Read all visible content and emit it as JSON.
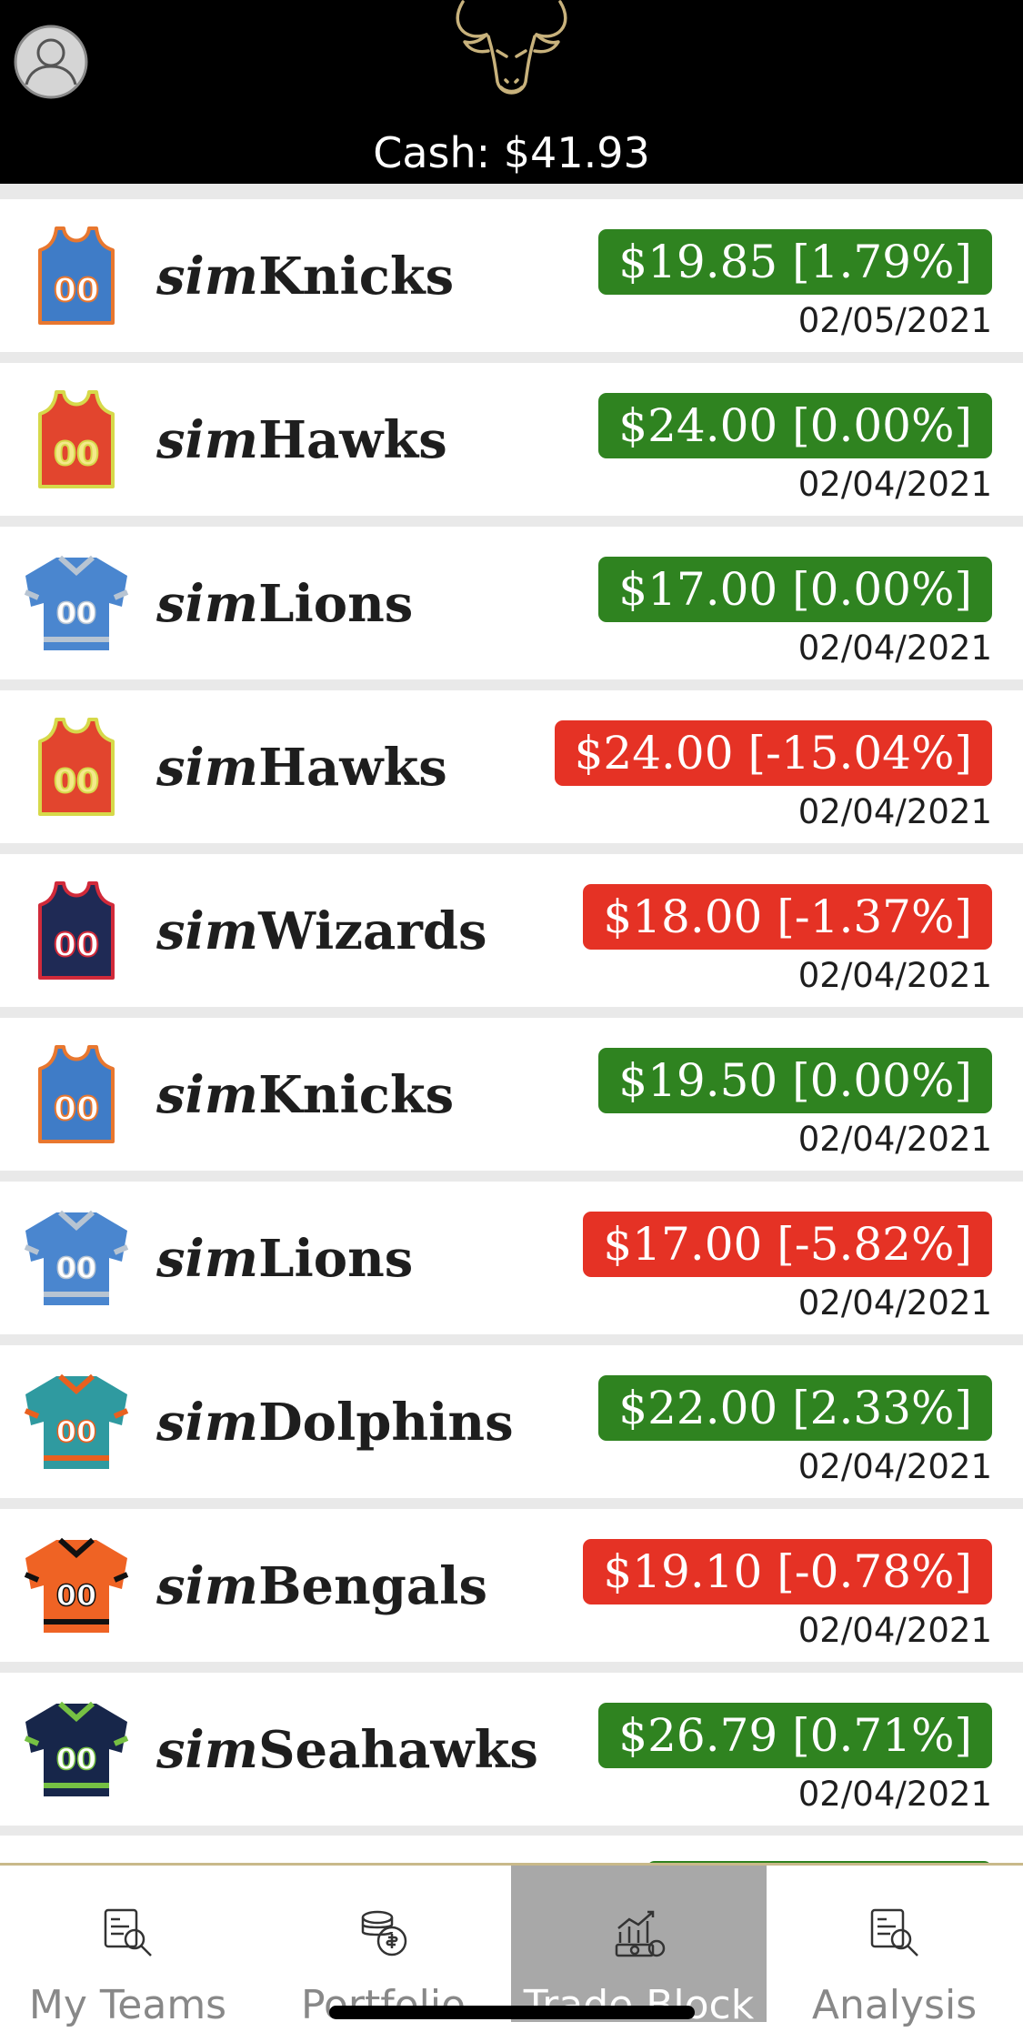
{
  "header": {
    "cash_label": "Cash: $41.93",
    "logo": "bull-head-icon",
    "avatar": "user-avatar-icon"
  },
  "colors": {
    "header_bg": "#000000",
    "up": "#2f8320",
    "down": "#e53225",
    "tab_active": "#a8a8a8"
  },
  "trades": [
    {
      "prefix": "sim",
      "name": "Knicks",
      "price": "$19.85 [1.79%]",
      "date": "02/05/2021",
      "trend": "up",
      "jersey": "basketball-jersey-icon"
    },
    {
      "prefix": "sim",
      "name": "Hawks",
      "price": "$24.00 [0.00%]",
      "date": "02/04/2021",
      "trend": "up",
      "jersey": "basketball-jersey-icon"
    },
    {
      "prefix": "sim",
      "name": "Lions",
      "price": "$17.00 [0.00%]",
      "date": "02/04/2021",
      "trend": "up",
      "jersey": "football-jersey-icon"
    },
    {
      "prefix": "sim",
      "name": "Hawks",
      "price": "$24.00 [-15.04%]",
      "date": "02/04/2021",
      "trend": "down",
      "jersey": "basketball-jersey-icon"
    },
    {
      "prefix": "sim",
      "name": "Wizards",
      "price": "$18.00 [-1.37%]",
      "date": "02/04/2021",
      "trend": "down",
      "jersey": "basketball-jersey-icon"
    },
    {
      "prefix": "sim",
      "name": "Knicks",
      "price": "$19.50 [0.00%]",
      "date": "02/04/2021",
      "trend": "up",
      "jersey": "basketball-jersey-icon"
    },
    {
      "prefix": "sim",
      "name": "Lions",
      "price": "$17.00 [-5.82%]",
      "date": "02/04/2021",
      "trend": "down",
      "jersey": "football-jersey-icon"
    },
    {
      "prefix": "sim",
      "name": "Dolphins",
      "price": "$22.00 [2.33%]",
      "date": "02/04/2021",
      "trend": "up",
      "jersey": "football-jersey-icon"
    },
    {
      "prefix": "sim",
      "name": "Bengals",
      "price": "$19.10 [-0.78%]",
      "date": "02/04/2021",
      "trend": "down",
      "jersey": "football-jersey-icon"
    },
    {
      "prefix": "sim",
      "name": "Seahawks",
      "price": "$26.79 [0.71%]",
      "date": "02/04/2021",
      "trend": "up",
      "jersey": "football-jersey-icon"
    }
  ],
  "tabs": [
    {
      "label": "My Teams",
      "icon": "team-search-icon",
      "active": false
    },
    {
      "label": "Portfolio",
      "icon": "portfolio-coins-icon",
      "active": false
    },
    {
      "label": "Trade Block",
      "icon": "trade-chart-icon",
      "active": true
    },
    {
      "label": "Analysis",
      "icon": "analysis-search-icon",
      "active": false
    }
  ]
}
